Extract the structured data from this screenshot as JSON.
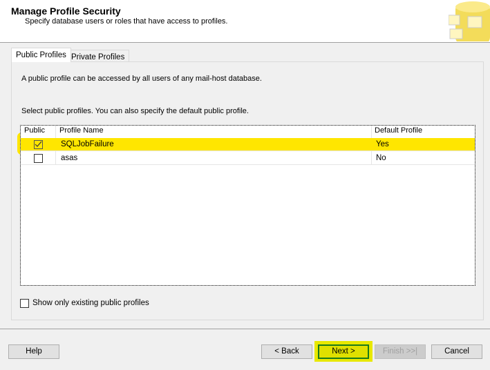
{
  "header": {
    "title": "Manage Profile Security",
    "subtitle": "Specify database users or roles that have access to profiles."
  },
  "tabs": [
    {
      "label": "Public Profiles"
    },
    {
      "label": "Private Profiles"
    }
  ],
  "panel": {
    "description": "A public profile can be accessed by all users of any mail-host database.",
    "instruction": "Select public profiles. You can also specify the default public profile."
  },
  "grid": {
    "columns": [
      "Public",
      "Profile Name",
      "Default Profile"
    ],
    "rows": [
      {
        "public": true,
        "name": "SQLJobFailure",
        "default": "Yes"
      },
      {
        "public": false,
        "name": "asas",
        "default": "No"
      }
    ]
  },
  "show_existing_label": "Show only existing public profiles",
  "buttons": {
    "help": "Help",
    "back": "< Back",
    "next": "Next >",
    "finish": "Finish >>|",
    "cancel": "Cancel"
  },
  "colors": {
    "highlight": "#ffe600"
  }
}
